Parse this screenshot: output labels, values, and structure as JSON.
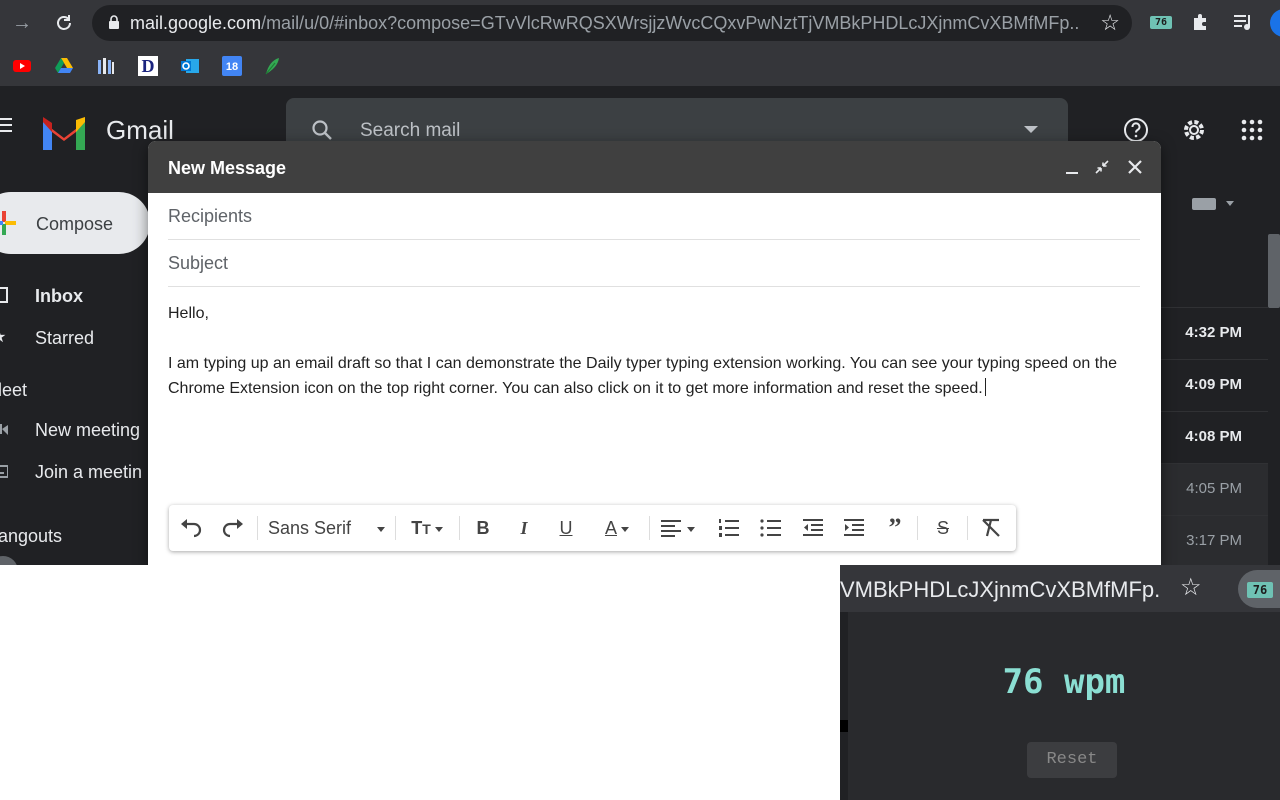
{
  "browser": {
    "url_domain": "mail.google.com",
    "url_rest": "/mail/u/0/#inbox?compose=GTvVlcRwRQSXWrsjjzWvcCQxvPwNztTjVMBkPHDLcJXjnmCvXBMfMFp...",
    "extension_badge": "76",
    "bookmarks": [
      "youtube-icon",
      "google-drive-icon",
      "library-icon",
      "d-icon",
      "outlook-icon",
      "calendar-icon",
      "feather-icon"
    ],
    "calendar_day": "18",
    "bookmark_d": "D"
  },
  "gmail": {
    "brand": "Gmail",
    "search_placeholder": "Search mail",
    "compose_label": "Compose",
    "sidebar": {
      "inbox": "Inbox",
      "starred": "Starred",
      "meet_heading": "leet",
      "new_meeting": "New meeting",
      "join_meeting": "Join a meetin",
      "hangouts_heading": "angouts"
    },
    "mail_times": [
      "4:32 PM",
      "4:09 PM",
      "4:08 PM",
      "4:05 PM",
      "3:17 PM"
    ]
  },
  "compose": {
    "title": "New Message",
    "recipients_placeholder": "Recipients",
    "subject_placeholder": "Subject",
    "body_greeting": "Hello,",
    "body_text": "I am typing up an email draft so that I can demonstrate the Daily typer typing extension working. You can see your typing speed on the Chrome Extension icon on the top right corner. You can also click on it to get more information and reset the speed.",
    "font_name": "Sans Serif"
  },
  "popup": {
    "url_fragment": "VMBkPHDLcJXjnmCvXBMfMFp...",
    "badge": "76",
    "wpm": "76 wpm",
    "reset_label": "Reset"
  },
  "colors": {
    "badge_teal": "#6fc2b4",
    "wpm_teal": "#8bdfd3",
    "compose_header": "#404040",
    "gmail_bg": "#202124"
  }
}
